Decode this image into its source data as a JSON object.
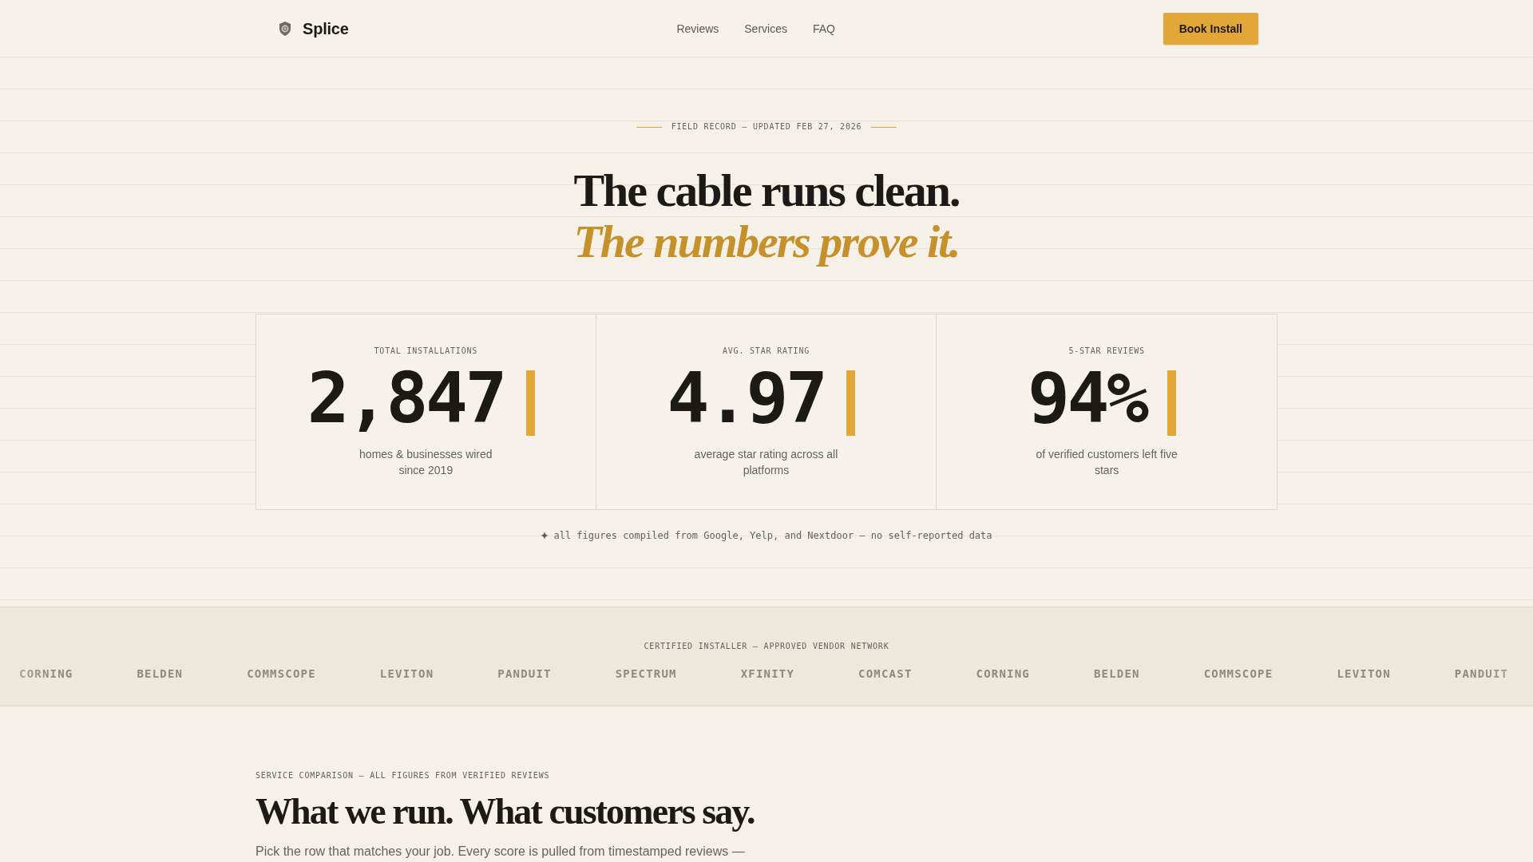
{
  "nav": {
    "brand": "Splice",
    "links": [
      "Reviews",
      "Services",
      "FAQ"
    ],
    "cta": "Book Install"
  },
  "hero": {
    "eyebrow": "FIELD RECORD — UPDATED FEB 27, 2026",
    "title": "The cable runs clean.",
    "title_accent": "The numbers prove it.",
    "stats": [
      {
        "label": "TOTAL INSTALLATIONS",
        "value": "2,847",
        "caption": "homes & businesses wired since 2019"
      },
      {
        "label": "AVG. STAR RATING",
        "value": "4.97",
        "caption": "average star rating across all platforms"
      },
      {
        "label": "5-STAR REVIEWS",
        "value": "94%",
        "caption": "of verified customers left five stars"
      }
    ],
    "footnote": "all figures compiled from Google, Yelp, and Nextdoor — no self-reported data"
  },
  "vendors": {
    "label": "CERTIFIED INSTALLER — APPROVED VENDOR NETWORK",
    "names": [
      "CORNING",
      "BELDEN",
      "COMMSCOPE",
      "LEVITON",
      "PANDUIT",
      "SPECTRUM",
      "XFINITY",
      "COMCAST",
      "CORNING",
      "BELDEN",
      "COMMSCOPE",
      "LEVITON",
      "PANDUIT"
    ]
  },
  "comparison": {
    "eyebrow": "SERVICE COMPARISON — ALL FIGURES FROM VERIFIED REVIEWS",
    "title": "What we run. What customers say.",
    "intro": "Pick the row that matches your job. Every score is pulled from timestamped reviews —"
  }
}
